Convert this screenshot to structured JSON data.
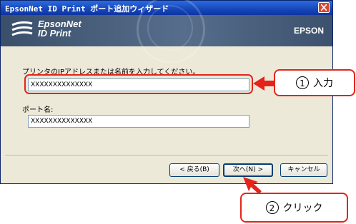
{
  "window": {
    "title": "EpsonNet ID Print ポート追加ウィザード"
  },
  "banner": {
    "logo_line1": "EpsonNet",
    "logo_line2": "ID Print",
    "brand": "EPSON"
  },
  "form": {
    "ip_label": "プリンタのIPアドレスまたは名前を入力してください。",
    "ip_value": "XXXXXXXXXXXXXX",
    "port_label": "ポート名:",
    "port_value": "XXXXXXXXXXXXXX"
  },
  "buttons": {
    "back": "< 戻る(B)",
    "next": "次へ(N) >",
    "cancel": "キャンセル"
  },
  "callouts": {
    "step1_number": "1",
    "step1_label": "入力",
    "step2_number": "2",
    "step2_label": "クリック"
  },
  "colors": {
    "highlight": "#e4241b",
    "titlebar": "#1746b8"
  }
}
